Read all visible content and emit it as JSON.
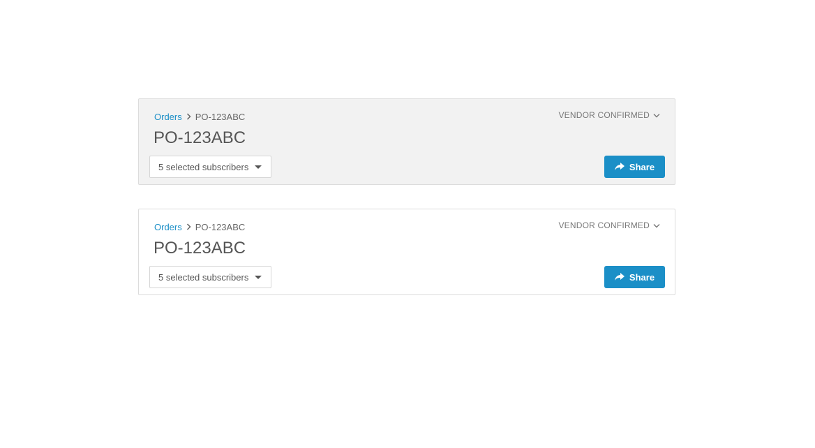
{
  "cards": [
    {
      "variant": "shaded",
      "breadcrumb": {
        "link": "Orders",
        "current": "PO-123ABC"
      },
      "status": "VENDOR CONFIRMED",
      "title": "PO-123ABC",
      "subscribers": "5 selected subscribers",
      "share_label": "Share"
    },
    {
      "variant": "plain",
      "breadcrumb": {
        "link": "Orders",
        "current": "PO-123ABC"
      },
      "status": "VENDOR CONFIRMED",
      "title": "PO-123ABC",
      "subscribers": "5 selected subscribers",
      "share_label": "Share"
    }
  ],
  "colors": {
    "accent": "#1b8fc7",
    "shaded_background": "#f2f2f2"
  },
  "icons": {
    "breadcrumb_separator": "chevron-right-icon",
    "status_dropdown": "chevron-down-icon",
    "subscribers_dropdown": "caret-down-icon",
    "share": "share-arrow-icon"
  }
}
